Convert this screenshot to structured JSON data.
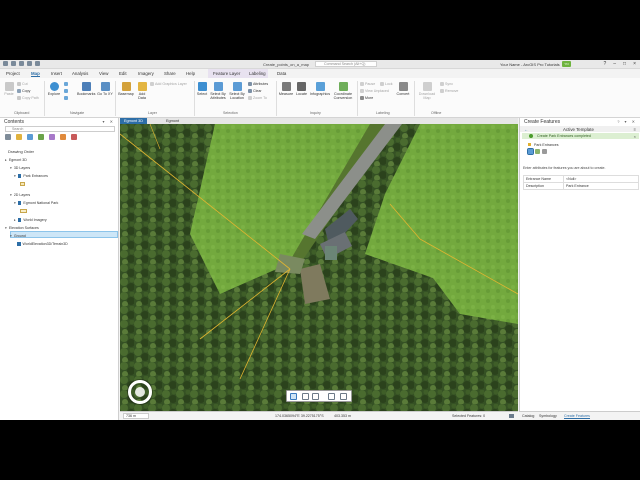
{
  "titlebar": {
    "document": "Create_points_on_a_map",
    "command_search": "Command Search (Alt+Q)",
    "user": "Your Name - ArcGIS Pro Tutorials",
    "user_badge": "YN"
  },
  "tabs": [
    "Project",
    "Map",
    "Insert",
    "Analysis",
    "View",
    "Edit",
    "Imagery",
    "Share",
    "Help",
    "Feature Layer",
    "Labeling",
    "Data"
  ],
  "active_tab": "Map",
  "ribbon": {
    "clipboard": {
      "paste": "Paste",
      "cut": "Cut",
      "copy": "Copy",
      "copy_path": "Copy Path",
      "group": "Clipboard"
    },
    "navigate": {
      "explore": "Explore",
      "full_extent": "",
      "bookmarks": "Bookmarks",
      "go_to": "Go To XY",
      "group": "Navigate"
    },
    "layer": {
      "basemap": "Basemap",
      "add_data": "Add Data",
      "add_graphics": "Add Graphics Layer",
      "group": "Layer"
    },
    "selection": {
      "select": "Select",
      "select_by_attributes": "Select By Attributes",
      "select_by_location": "Select By Location",
      "attributes": "Attributes",
      "clear": "Clear",
      "zoom_to": "Zoom To",
      "group": "Selection"
    },
    "inquiry": {
      "measure": "Measure",
      "locate": "Locate",
      "infographics": "Infographics",
      "coordinate_conversion": "Coordinate Conversion",
      "group": "Inquiry"
    },
    "labeling": {
      "pause": "Pause",
      "lock": "Lock",
      "view_unplaced": "View Unplaced",
      "more": "More",
      "convert": "Convert",
      "group": "Labeling"
    },
    "offline": {
      "download_map": "Download Map",
      "sync": "Sync",
      "remove": "Remove",
      "group": "Offline"
    }
  },
  "contents": {
    "title": "Contents",
    "search_placeholder": "Search",
    "drawing_order": "Drawing Order",
    "tree": [
      "Egmont 3D",
      "3D Layers",
      "Park Entrances",
      "2D Layers",
      "Egmont National Park",
      "World Imagery",
      "Elevation Surfaces",
      "Ground",
      "WorldElevation3D/Terrain3D"
    ]
  },
  "map": {
    "tabs": [
      "Egmont 3D",
      "Egmont"
    ],
    "scale": "736 m",
    "coordinates": "174.0365094°E 39.2275175°S",
    "elevation": "403.353 m",
    "selected_features": "Selected Features: 0"
  },
  "create_features": {
    "title": "Create Features",
    "active_template": "Active Template",
    "status": "Create Park Entrances completed",
    "layer": "Park Entrances",
    "hint": "Enter attributes for features you are about to create.",
    "fields": [
      {
        "name": "Entrance Name",
        "value": "<Null>"
      },
      {
        "name": "Description",
        "value": "Park Entrance"
      }
    ],
    "bottom_tabs": [
      "Catalog",
      "Symbology",
      "Create Features"
    ],
    "active_bottom_tab": "Create Features"
  },
  "colors": {
    "accent": "#2d6ea7",
    "status_ok": "#4a9b2b"
  }
}
